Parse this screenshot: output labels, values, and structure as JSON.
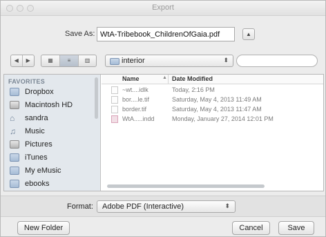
{
  "window": {
    "title": "Export"
  },
  "save_as": {
    "label": "Save As:",
    "value": "WtA-Tribebook_ChildrenOfGaia.pdf",
    "expand_glyph": "▲"
  },
  "toolbar": {
    "back_glyph": "◀",
    "forward_glyph": "▶",
    "view_icons_glyph": "▦",
    "view_list_glyph": "≡",
    "view_columns_glyph": "▥",
    "folder_name": "interior",
    "folder_chevron": "⬍",
    "search_placeholder": ""
  },
  "sidebar": {
    "heading": "FAVORITES",
    "items": [
      {
        "label": "Dropbox",
        "icon": "folder-icon"
      },
      {
        "label": "Macintosh HD",
        "icon": "hard-drive-icon"
      },
      {
        "label": "sandra",
        "icon": "home-icon"
      },
      {
        "label": "Music",
        "icon": "music-icon"
      },
      {
        "label": "Pictures",
        "icon": "camera-icon"
      },
      {
        "label": "iTunes",
        "icon": "folder-icon"
      },
      {
        "label": "My eMusic",
        "icon": "folder-icon"
      },
      {
        "label": "ebooks",
        "icon": "folder-icon"
      }
    ]
  },
  "file_list": {
    "columns": {
      "name": "Name",
      "date": "Date Modified"
    },
    "rows": [
      {
        "name": "~wt....idlk",
        "date": "Today, 2:16 PM",
        "icon": "text-file-icon"
      },
      {
        "name": "bor....le.tif",
        "date": "Saturday, May 4, 2013 11:49 AM",
        "icon": "image-file-icon"
      },
      {
        "name": "border.tif",
        "date": "Saturday, May 4, 2013 11:47 AM",
        "icon": "image-file-icon"
      },
      {
        "name": "WtA.....indd",
        "date": "Monday, January 27, 2014 12:01 PM",
        "icon": "indesign-file-icon"
      }
    ]
  },
  "format": {
    "label": "Format:",
    "value": "Adobe PDF (Interactive)",
    "chevron": "⬍"
  },
  "buttons": {
    "new_folder": "New Folder",
    "cancel": "Cancel",
    "save": "Save"
  }
}
